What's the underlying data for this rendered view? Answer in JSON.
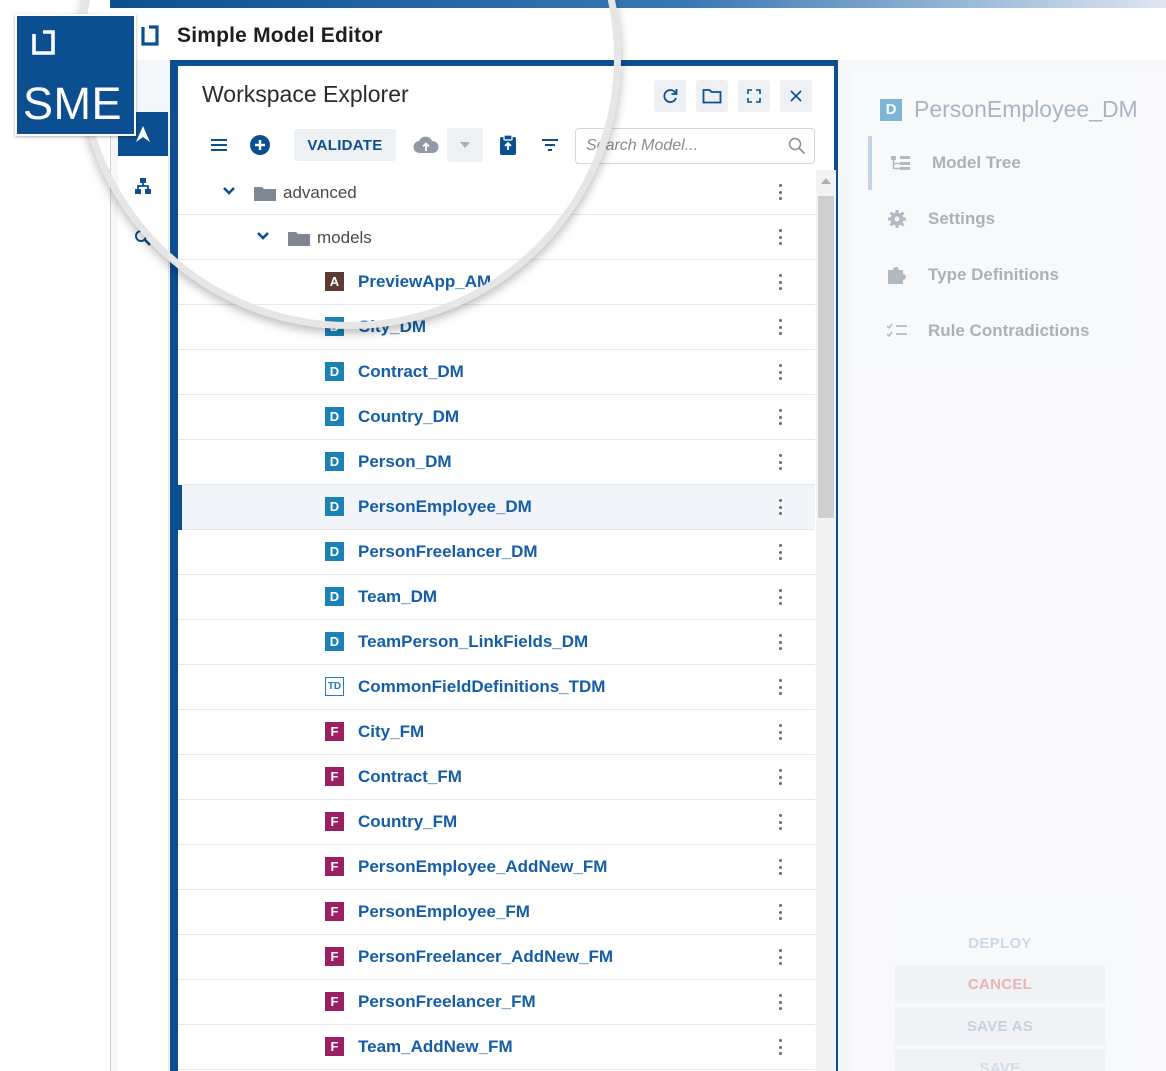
{
  "brand": {
    "badge_text": "SME",
    "color": "#0b4f91"
  },
  "app": {
    "title": "Simple Model Editor"
  },
  "explorer": {
    "title": "Workspace Explorer",
    "header_icons": [
      "refresh-icon",
      "folder-icon",
      "expand-icon",
      "close-icon"
    ],
    "toolbar": {
      "validate_label": "VALIDATE",
      "icons": [
        "menu-icon",
        "add-circle-icon",
        "cloud-upload-icon",
        "dropdown-icon",
        "clipboard-icon",
        "filter-icon"
      ]
    },
    "search": {
      "placeholder": "Search Model..."
    },
    "tree": [
      {
        "kind": "folder",
        "label": "advanced",
        "expanded": true
      },
      {
        "kind": "folder",
        "label": "models",
        "expanded": true
      },
      {
        "kind": "item",
        "badge": "A",
        "label": "PreviewApp_AM"
      },
      {
        "kind": "item",
        "badge": "D",
        "label": "City_DM"
      },
      {
        "kind": "item",
        "badge": "D",
        "label": "Contract_DM"
      },
      {
        "kind": "item",
        "badge": "D",
        "label": "Country_DM"
      },
      {
        "kind": "item",
        "badge": "D",
        "label": "Person_DM"
      },
      {
        "kind": "item",
        "badge": "D",
        "label": "PersonEmployee_DM",
        "selected": true
      },
      {
        "kind": "item",
        "badge": "D",
        "label": "PersonFreelancer_DM"
      },
      {
        "kind": "item",
        "badge": "D",
        "label": "Team_DM"
      },
      {
        "kind": "item",
        "badge": "D",
        "label": "TeamPerson_LinkFields_DM"
      },
      {
        "kind": "item",
        "badge": "TD",
        "label": "CommonFieldDefinitions_TDM"
      },
      {
        "kind": "item",
        "badge": "F",
        "label": "City_FM"
      },
      {
        "kind": "item",
        "badge": "F",
        "label": "Contract_FM"
      },
      {
        "kind": "item",
        "badge": "F",
        "label": "Country_FM"
      },
      {
        "kind": "item",
        "badge": "F",
        "label": "PersonEmployee_AddNew_FM"
      },
      {
        "kind": "item",
        "badge": "F",
        "label": "PersonEmployee_FM"
      },
      {
        "kind": "item",
        "badge": "F",
        "label": "PersonFreelancer_AddNew_FM"
      },
      {
        "kind": "item",
        "badge": "F",
        "label": "PersonFreelancer_FM"
      },
      {
        "kind": "item",
        "badge": "F",
        "label": "Team_AddNew_FM"
      }
    ]
  },
  "detail": {
    "badge": "D",
    "title": "PersonEmployee_DM",
    "nav": [
      {
        "label": "Model Tree",
        "icon": "model-tree-icon",
        "active": true
      },
      {
        "label": "Settings",
        "icon": "gear-icon"
      },
      {
        "label": "Type Definitions",
        "icon": "puzzle-icon"
      },
      {
        "label": "Rule Contradictions",
        "icon": "checklist-icon"
      }
    ],
    "buttons": {
      "deploy": "DEPLOY",
      "cancel": "CANCEL",
      "save_as": "SAVE AS",
      "save": "SAVE"
    }
  },
  "colors": {
    "primary": "#0b4f91",
    "link": "#155ea6",
    "badge_a": "#5c3b34",
    "badge_d": "#1c82b6",
    "badge_f": "#9b1f63",
    "cancel": "#e07b7b"
  }
}
